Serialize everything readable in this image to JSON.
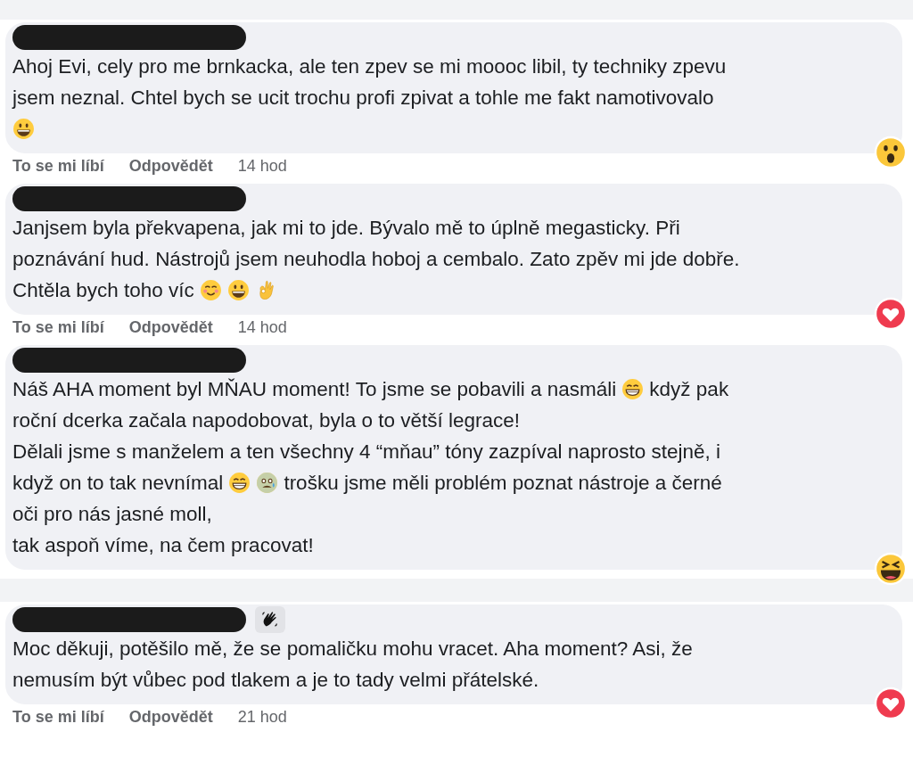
{
  "comments": [
    {
      "lines": [
        [
          {
            "kind": "text",
            "text": "Ahoj Evi, cely pro me brnkacka, ale ten zpev se mi moooc libil, ty techniky zpevu"
          }
        ],
        [
          {
            "kind": "text",
            "text": "jsem neznal. Chtel bych se ucit trochu profi zpivat a tohle me fakt namotivovalo"
          }
        ],
        [
          {
            "kind": "grinning"
          }
        ]
      ],
      "reaction": {
        "kind": "wow"
      },
      "actions": {
        "like": "To se mi líbí",
        "reply": "Odpovědět",
        "time": "14 hod"
      }
    },
    {
      "lines": [
        [
          {
            "kind": "text",
            "text": "Janjsem byla překvapena, jak mi to jde. Bývalo mě to úplně megasticky. Při"
          }
        ],
        [
          {
            "kind": "text",
            "text": "poznávání hud. Nástrojů jsem neuhodla hoboj a cembalo. Zato zpěv mi jde dobře."
          }
        ],
        [
          {
            "kind": "text",
            "text": "Chtěla bych toho víc"
          },
          {
            "kind": "blushing"
          },
          {
            "kind": "grinning"
          },
          {
            "kind": "okhand"
          }
        ]
      ],
      "reaction": {
        "kind": "love"
      },
      "actions": {
        "like": "To se mi líbí",
        "reply": "Odpovědět",
        "time": "14 hod"
      }
    },
    {
      "lines": [
        [
          {
            "kind": "text",
            "text": "Náš AHA moment byl MŇAU moment! To jsme se pobavili a nasmáli"
          },
          {
            "kind": "beaming"
          },
          {
            "kind": "text",
            "text": "když pak"
          }
        ],
        [
          {
            "kind": "text",
            "text": "roční dcerka začala napodobovat, byla o to větší legrace!"
          }
        ],
        [
          {
            "kind": "text",
            "text": "Dělali jsme s manželem a ten všechny 4 “mňau” tóny zazpíval naprosto stejně, i"
          }
        ],
        [
          {
            "kind": "text",
            "text": "když on to tak nevnímal"
          },
          {
            "kind": "beaming"
          },
          {
            "kind": "fearful"
          },
          {
            "kind": "text",
            "text": "trošku jsme měli problém poznat nástroje a černé"
          }
        ],
        [
          {
            "kind": "text",
            "text": "oči pro nás jasné moll,"
          }
        ],
        [
          {
            "kind": "text",
            "text": "tak aspoň víme, na čem pracovat!"
          }
        ]
      ],
      "reaction": {
        "kind": "haha"
      }
    },
    {
      "badge": {
        "kind": "wave"
      },
      "lines": [
        [
          {
            "kind": "text",
            "text": "Moc děkuji, potěšilo mě, že se pomaličku mohu vracet. Aha moment? Asi, že"
          }
        ],
        [
          {
            "kind": "text",
            "text": "nemusím být vůbec pod tlakem a je to tady velmi přátelské."
          }
        ]
      ],
      "reaction": {
        "kind": "love"
      },
      "actions": {
        "like": "To se mi líbí",
        "reply": "Odpovědět",
        "time": "21 hod"
      }
    }
  ]
}
